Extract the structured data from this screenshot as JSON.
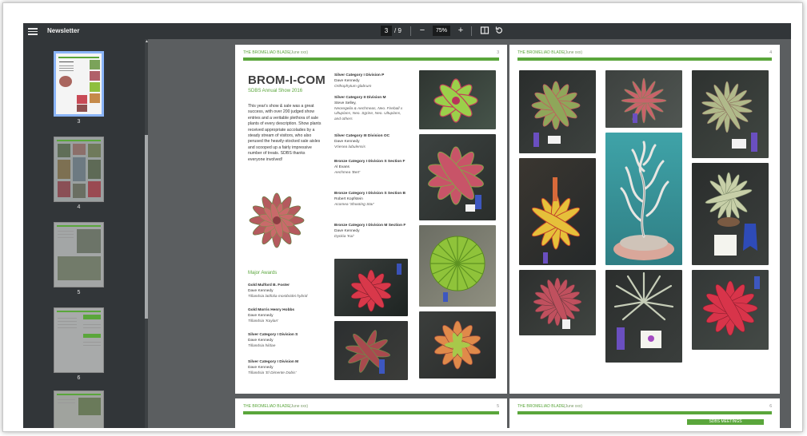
{
  "toolbar": {
    "title": "Newsletter",
    "current_page": "3",
    "page_separator": "/",
    "total_pages": "9",
    "zoom": "75%",
    "zoom_out": "−",
    "zoom_in": "+"
  },
  "sidebar": {
    "thumbnails": [
      {
        "num": "3"
      },
      {
        "num": "4"
      },
      {
        "num": "5"
      },
      {
        "num": "6"
      }
    ]
  },
  "left_page": {
    "header_name": "THE BROMELIAD BLADE",
    "header_date": "(June xxx)",
    "header_num": "3",
    "title": "BROM-I-COM",
    "subtitle": "SDBS Annual Show 2016",
    "intro": "This year's show & sale was a great success, with over 200 judged show entries and a veritable plethora of sale plants of every description. Show plants received appropriate accolades by a steady stream of visitors, who also perused the heavily-stocked sale aisles and scooped up a fairly impressive number of treats. SDBS thanks everyone involved!",
    "major_awards_label": "Major Awards",
    "awards_left": [
      {
        "title": "Gold Mulford B. Foster",
        "person": "Dave Kennedy",
        "plant": "Tillandsia latifolia mostbridei hybrid"
      },
      {
        "title": "Gold Morris Henry Hobbs",
        "person": "Dave Kennedy",
        "plant": "Tillandsia 'Kaylan'"
      },
      {
        "title": "Silver Category I Division S",
        "person": "Dave Kennedy",
        "plant": "Tillandsia hildae"
      },
      {
        "title": "Silver Category I Division M",
        "person": "Dave Kennedy",
        "plant": "Tillandsia 'El Dimente Dobis'"
      }
    ],
    "awards_mid": [
      {
        "title": "Silver Category I Division P",
        "person": "Dave Kennedy",
        "plant": "Orthophytum glabrum"
      },
      {
        "title": "Silver Category II Division M",
        "person": "Steve Selley,",
        "plant": "Neoregelia & Aechmeas, Neo. Fireball x Ultuplans, Neo. Sgrine, Neo. Ultuplans, and others"
      },
      {
        "title": "Silver Category III Division OC",
        "person": "Dave Kennedy",
        "plant": "Vriesea lubulensis"
      },
      {
        "title": "Bronze Category I Division S Section F",
        "person": "Al Evans",
        "plant": "Aechmea 'Bert'"
      },
      {
        "title": "Bronze Category I Division S Section B",
        "person": "Robert Kopfstein",
        "plant": "Acomea 'Shooting Star'"
      },
      {
        "title": "Bronze Category I Division M Section F",
        "person": "Dave Kennedy",
        "plant": "Dyckia 'Kai'"
      }
    ]
  },
  "right_page": {
    "header_name": "THE BROMELIAD BLADE",
    "header_date": "(June xxx)",
    "header_num": "4"
  },
  "bottom_left_page": {
    "header_name": "THE BROMELIAD BLADE",
    "header_date": "(June xxx)",
    "header_num": "5"
  },
  "bottom_right_page": {
    "header_name": "THE BROMELIAD BLADE",
    "header_date": "(June xxx)",
    "header_num": "6",
    "tab_label": "SDBS MEETINGS"
  },
  "colors": {
    "accent": "#5aa63b",
    "toolbar": "#323639",
    "viewer_bg": "#5b5e60",
    "active_thumb": "#8ab4f8"
  }
}
